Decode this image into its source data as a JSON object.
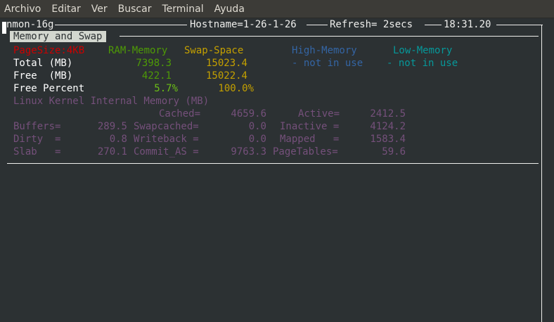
{
  "menubar": {
    "items": [
      "Archivo",
      "Editar",
      "Ver",
      "Buscar",
      "Terminal",
      "Ayuda"
    ]
  },
  "header": {
    "program": "nmon-16g",
    "hostname": "Hostname=1-26-1-26",
    "refresh": "Refresh= 2secs",
    "time": "18:31.20"
  },
  "section": {
    "title": "Memory and Swap"
  },
  "memory_table": {
    "pagesize": "PageSize:4KB",
    "col_ram": "RAM-Memory",
    "col_swap": "Swap-Space",
    "col_high": "High-Memory",
    "col_low": "Low-Memory",
    "rows": [
      {
        "label": "Total (MB)",
        "ram": "7398.3",
        "swap": "15023.4",
        "high": "- not in use",
        "low": "- not in use"
      },
      {
        "label": "Free  (MB)",
        "ram": "422.1",
        "swap": "15022.4"
      },
      {
        "label": "Free Percent",
        "ram": "5.7%",
        "swap": "100.0%"
      }
    ]
  },
  "kernel": {
    "heading": "Linux Kernel Internal Memory (MB)",
    "cached_label": "Cached=",
    "cached": "4659.6",
    "active_label": "Active=",
    "active": "2412.5",
    "buffers_label": "Buffers=",
    "buffers": "289.5",
    "swapcached_label": "Swapcached=",
    "swapcached": "0.0",
    "inactive_label": "Inactive =",
    "inactive": "4124.2",
    "dirty_label": "Dirty  =",
    "dirty": "0.8",
    "writeback_label": "Writeback =",
    "writeback": "0.0",
    "mapped_label": "Mapped   =",
    "mapped": "1583.4",
    "slab_label": "Slab   =",
    "slab": "270.1",
    "commit_label": "Commit_AS =",
    "commit": "9763.3",
    "pagetables_label": "PageTables=",
    "pagetables": "59.6"
  },
  "colors": {
    "background": "#2c3133",
    "menubar": "#3c3b37",
    "red": "#cc0000",
    "green": "#4e9a06",
    "yellow": "#c4a000",
    "blue": "#3465a4",
    "cyan": "#06989a",
    "magenta": "#75507b"
  }
}
